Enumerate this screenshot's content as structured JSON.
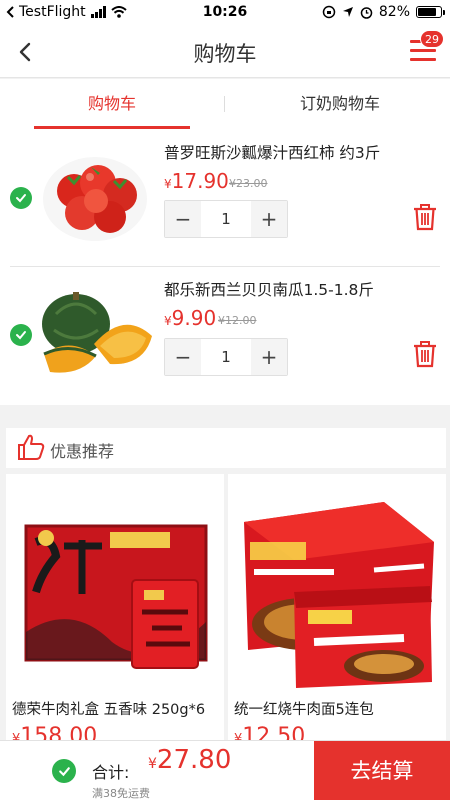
{
  "status_bar": {
    "carrier": "TestFlight",
    "time": "10:26",
    "battery": "82%",
    "battery_level": 0.82
  },
  "nav": {
    "title": "购物车",
    "badge": "29"
  },
  "tabs": [
    {
      "label": "购物车",
      "active": true
    },
    {
      "label": "订奶购物车",
      "active": false
    }
  ],
  "cart_items": [
    {
      "name": "普罗旺斯沙瓤爆汁西红柿 约3斤",
      "currency": "¥",
      "price": "17.90",
      "original_price": "¥23.00",
      "quantity": "1",
      "minus": "−",
      "plus": "+",
      "checked": true
    },
    {
      "name": "都乐新西兰贝贝南瓜1.5-1.8斤",
      "currency": "¥",
      "price": "9.90",
      "original_price": "¥12.00",
      "quantity": "1",
      "minus": "−",
      "plus": "+",
      "checked": true
    }
  ],
  "recommend": {
    "title": "优惠推荐",
    "products": [
      {
        "name": "德荣牛肉礼盒 五香味 250g*6",
        "currency": "¥",
        "price": "158.00"
      },
      {
        "name": "统一红烧牛肉面5连包",
        "currency": "¥",
        "price": "12.50"
      }
    ]
  },
  "bottom_bar": {
    "total_label": "合计:",
    "currency": "¥",
    "total": "27.80",
    "shipping_note": "满38免运费",
    "checkout_label": "去结算"
  },
  "colors": {
    "accent": "#e5322d",
    "check": "#2bb24c"
  }
}
